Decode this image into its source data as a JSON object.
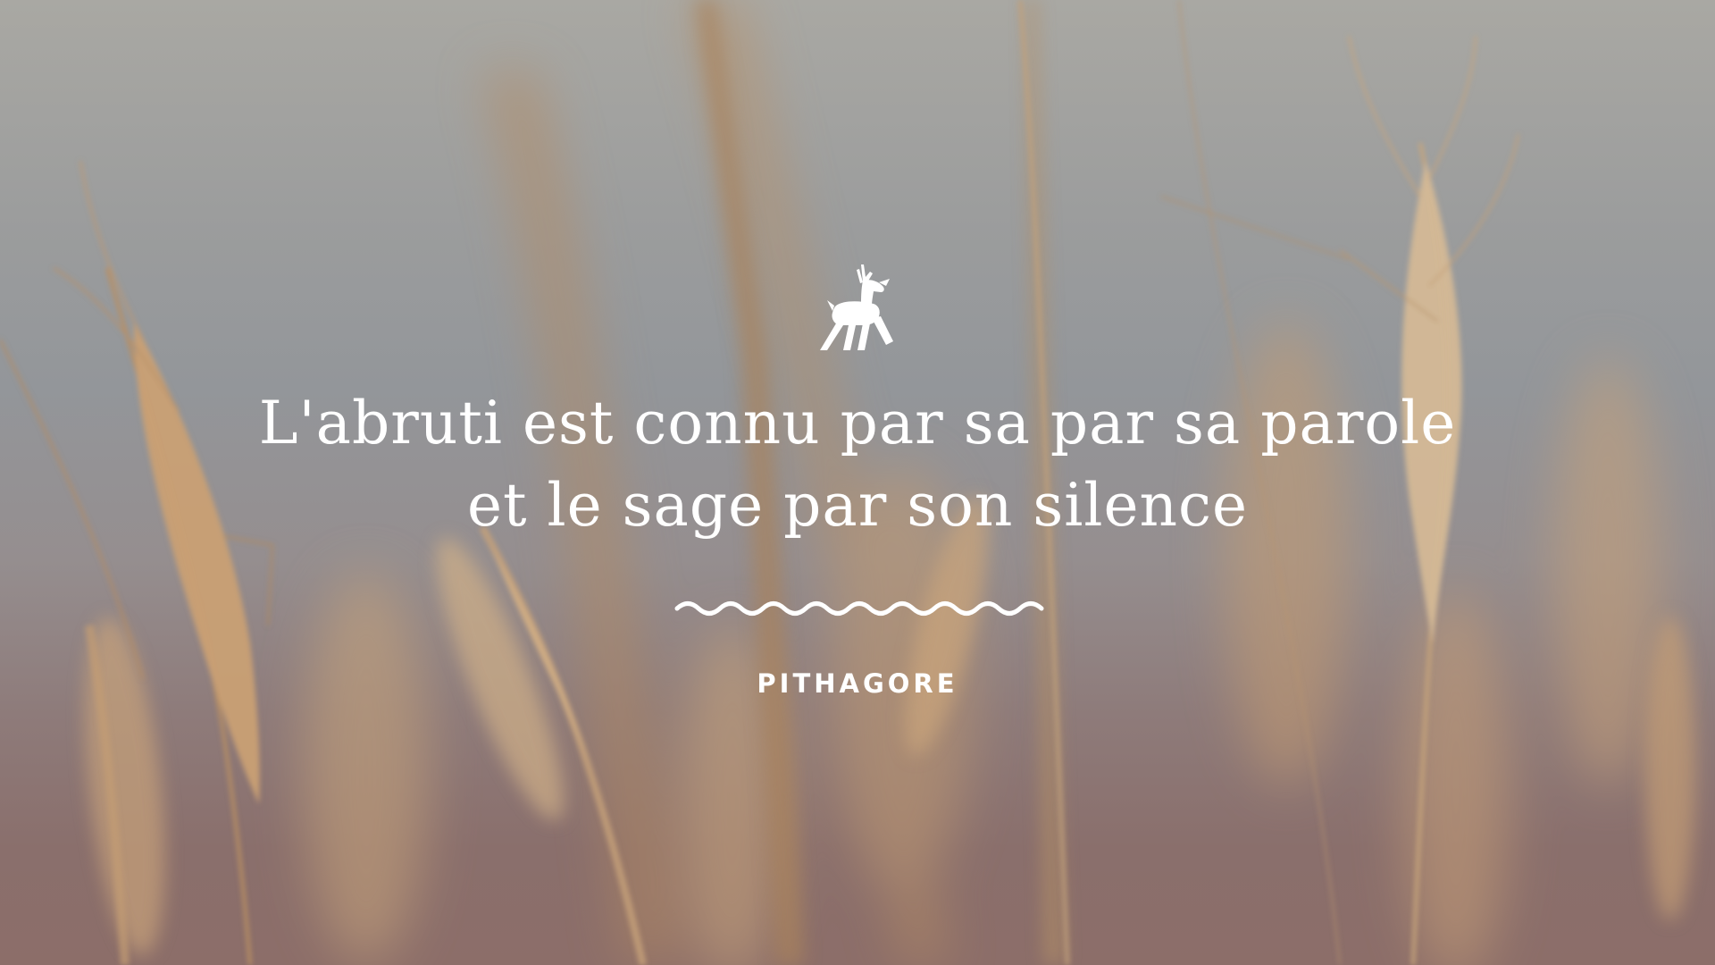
{
  "quote": {
    "text": "L'abruti est connu par sa par sa parole et le sage par son silence",
    "author": "PITHAGORE"
  },
  "icons": {
    "top": "deer-icon",
    "divider": "wave-divider"
  },
  "colors": {
    "text": "#ffffff",
    "background_top": "#a9a8a3",
    "background_bottom": "#8c6e69",
    "wheat": "#c9a173"
  }
}
